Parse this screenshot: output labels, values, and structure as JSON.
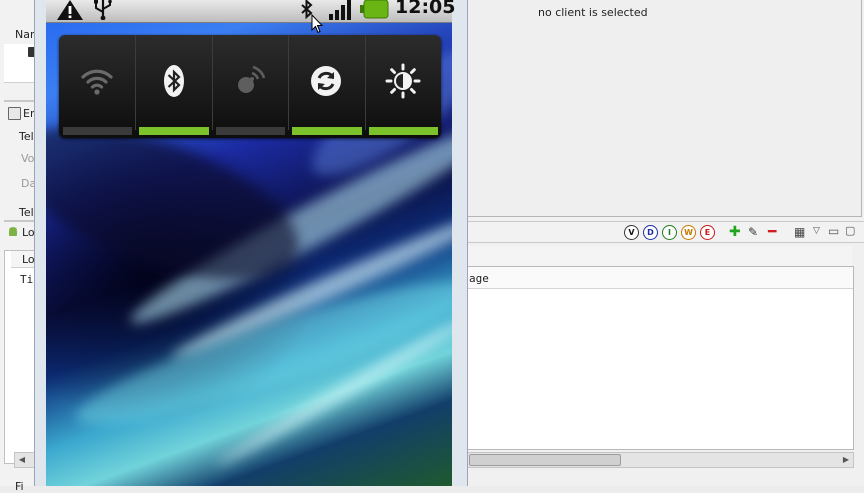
{
  "ddms": {
    "left": {
      "name_header": "Name",
      "section_e": "Er",
      "row_tel1": "Tel",
      "row_vo": "Vo",
      "row_da": "Da",
      "row_tel2": "Tel",
      "logcat_tab": "Lo",
      "log_tab": "Log",
      "time_col": "Ti",
      "filter_label": "Fi"
    },
    "client_message": "no client is selected",
    "log_message_col": "age",
    "log_levels": [
      "V",
      "D",
      "I",
      "W",
      "E"
    ],
    "colors": {
      "verbose": "#1c1c1c",
      "debug": "#1a2fa8",
      "info": "#1d7c1d",
      "warn": "#c77800",
      "error": "#c71818"
    }
  },
  "emulator": {
    "status_bar": {
      "icons": [
        "warning-icon",
        "usb-icon",
        "bluetooth-icon",
        "signal-icon",
        "battery-icon"
      ],
      "time": "12:05"
    },
    "power_widget": {
      "buttons": [
        {
          "name": "wifi",
          "icon": "wifi-icon",
          "on": false
        },
        {
          "name": "bluetooth",
          "icon": "bluetooth-icon",
          "on": true
        },
        {
          "name": "gps",
          "icon": "gps-icon",
          "on": false
        },
        {
          "name": "sync",
          "icon": "sync-icon",
          "on": true
        },
        {
          "name": "brightness",
          "icon": "brightness-icon",
          "on": true
        }
      ],
      "on_color": "#7cc22b",
      "off_color": "#3a3a3a"
    }
  }
}
